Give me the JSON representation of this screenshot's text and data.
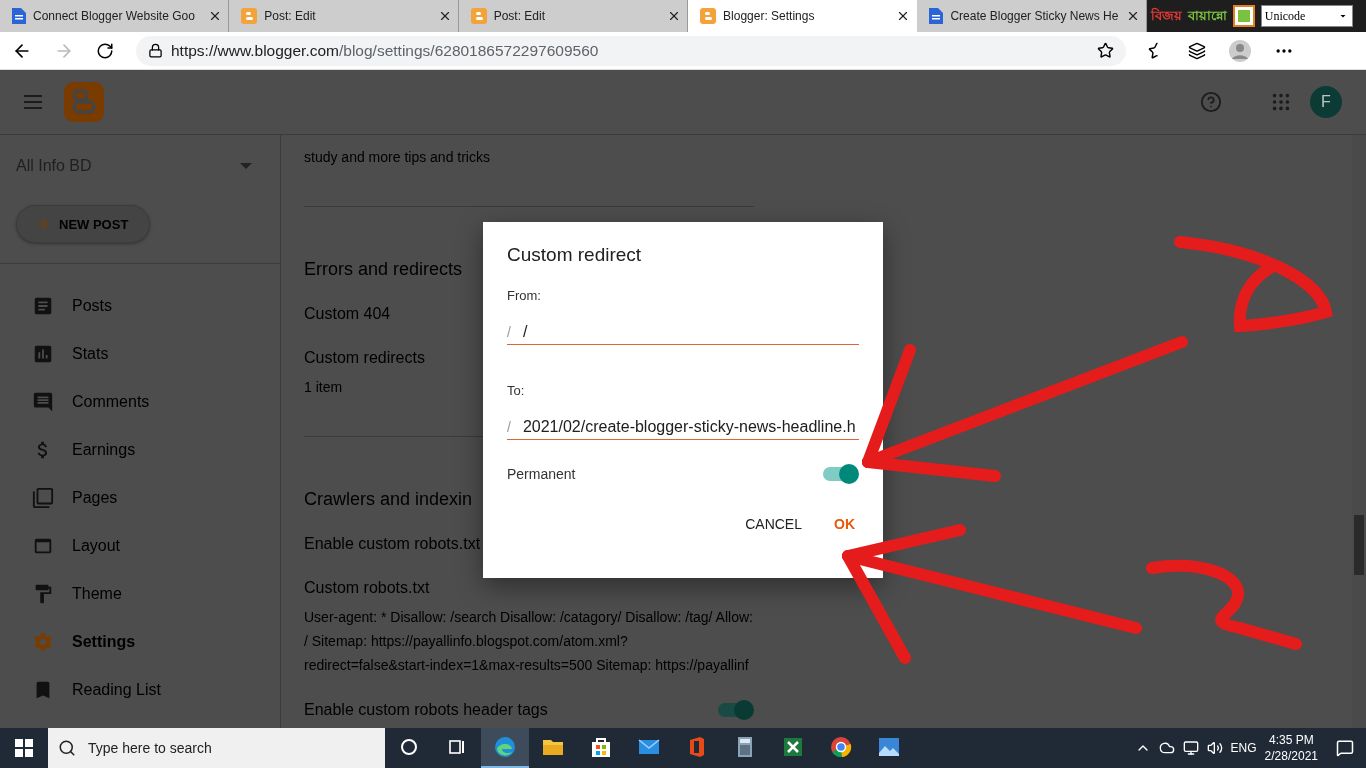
{
  "browser": {
    "tabs": [
      {
        "title": "Connect Blogger Website Goo",
        "kind": "doc",
        "selected": false
      },
      {
        "title": "Post: Edit",
        "kind": "blogger",
        "selected": false
      },
      {
        "title": "Post: Edit",
        "kind": "blogger",
        "selected": false
      },
      {
        "title": "Blogger: Settings",
        "kind": "blogger",
        "selected": true
      },
      {
        "title": "Create Blogger Sticky News He",
        "kind": "doc",
        "selected": false
      }
    ],
    "url": {
      "host": "https://www.blogger.com",
      "path": "/blog/settings/6280186572297609560"
    }
  },
  "keyboard_widget": {
    "label_1": "বিজয়",
    "label_2": "বায়ান্নো",
    "layout": "Unicode"
  },
  "header": {
    "avatar": "F"
  },
  "sidebar": {
    "blog": "All Info BD",
    "new_post": "NEW POST",
    "items": [
      {
        "label": "Posts",
        "kind": "posts",
        "selected": false
      },
      {
        "label": "Stats",
        "kind": "stats",
        "selected": false
      },
      {
        "label": "Comments",
        "kind": "comments",
        "selected": false
      },
      {
        "label": "Earnings",
        "kind": "earnings",
        "selected": false
      },
      {
        "label": "Pages",
        "kind": "pages",
        "selected": false
      },
      {
        "label": "Layout",
        "kind": "layout",
        "selected": false
      },
      {
        "label": "Theme",
        "kind": "theme",
        "selected": false
      },
      {
        "label": "Settings",
        "kind": "settings",
        "selected": true
      },
      {
        "label": "Reading List",
        "kind": "reading",
        "selected": false
      }
    ]
  },
  "content": {
    "intro": "study and more tips and tricks",
    "sections": [
      {
        "heading": "Errors and redirects",
        "rows": [
          {
            "title": "Custom 404"
          },
          {
            "title": "Custom redirects",
            "detail": "1 item"
          }
        ]
      },
      {
        "heading": "Crawlers and indexin",
        "rows": [
          {
            "title": "Enable custom robots.txt"
          },
          {
            "title": "Custom robots.txt",
            "detail": "User-agent: * Disallow: /search Disallow: /catagory/ Disallow: /tag/ Allow: / Sitemap: https://payallinfo.blogspot.com/atom.xml? redirect=false&start-index=1&max-results=500 Sitemap: https://payallinf"
          },
          {
            "title": "Enable custom robots header tags",
            "on": true
          }
        ]
      }
    ]
  },
  "dialog": {
    "title": "Custom redirect",
    "fields": [
      {
        "label": "From:",
        "prefix": "/",
        "value": "/"
      },
      {
        "label": "To:",
        "prefix": "/",
        "value": "2021/02/create-blogger-sticky-news-headline.h"
      }
    ],
    "permanent": {
      "label": "Permanent",
      "on": true
    },
    "buttons": [
      {
        "label": "CANCEL",
        "kind": "text"
      },
      {
        "label": "OK",
        "kind": "primary"
      }
    ]
  },
  "taskbar": {
    "search_placeholder": "Type here to search",
    "apps": [
      {
        "kind": "cortana",
        "selected": false
      },
      {
        "kind": "taskview",
        "selected": false
      },
      {
        "kind": "edge",
        "selected": true
      },
      {
        "kind": "explorer",
        "selected": false
      },
      {
        "kind": "store",
        "selected": false
      },
      {
        "kind": "mail",
        "selected": false
      },
      {
        "kind": "office",
        "selected": false
      },
      {
        "kind": "calculator",
        "selected": false
      },
      {
        "kind": "excel",
        "selected": false
      },
      {
        "kind": "chrome",
        "selected": false
      },
      {
        "kind": "photos",
        "selected": false
      }
    ],
    "language": "ENG",
    "time": "4:35 PM",
    "date": "2/28/2021"
  }
}
